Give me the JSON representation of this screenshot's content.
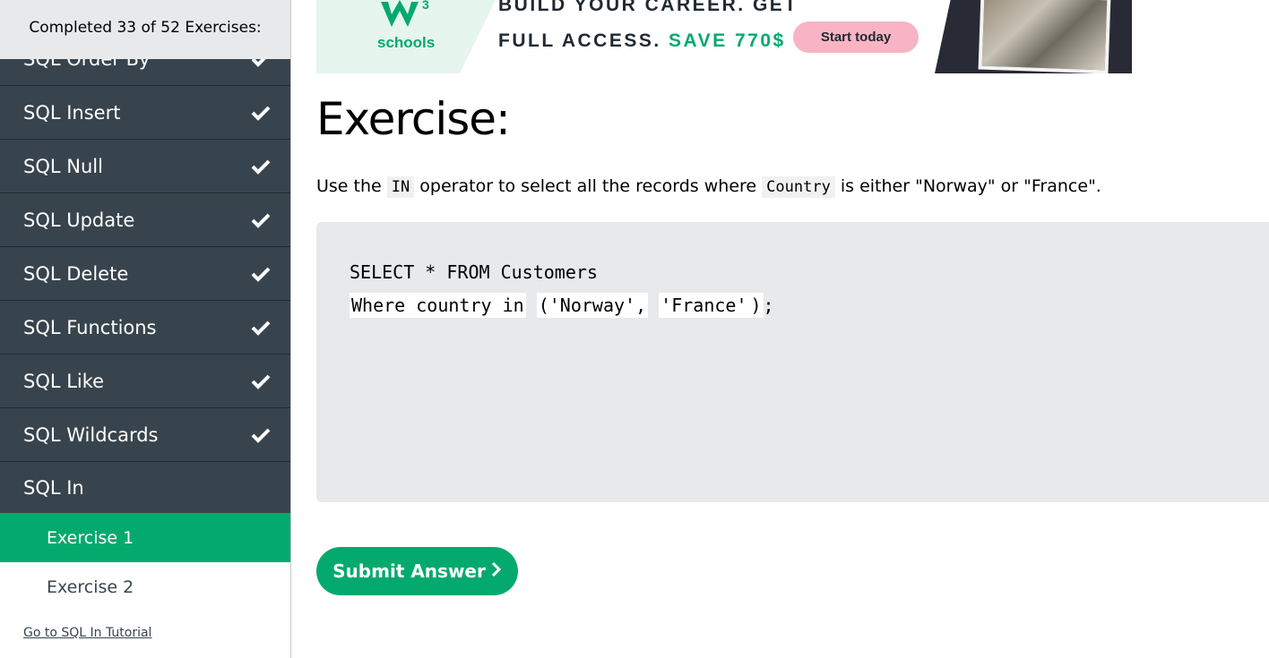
{
  "sidebar": {
    "progress_text": "Completed 33 of 52 Exercises:",
    "topics": [
      {
        "label": "SQL Order By",
        "completed": true
      },
      {
        "label": "SQL Insert",
        "completed": true
      },
      {
        "label": "SQL Null",
        "completed": true
      },
      {
        "label": "SQL Update",
        "completed": true
      },
      {
        "label": "SQL Delete",
        "completed": true
      },
      {
        "label": "SQL Functions",
        "completed": true
      },
      {
        "label": "SQL Like",
        "completed": true
      },
      {
        "label": "SQL Wildcards",
        "completed": true
      },
      {
        "label": "SQL In",
        "completed": false
      }
    ],
    "sub_items": [
      {
        "label": "Exercise 1",
        "selected": true
      },
      {
        "label": "Exercise 2",
        "selected": false
      }
    ],
    "tutorial_link": "Go to SQL In Tutorial"
  },
  "banner": {
    "logo_mark": "W",
    "logo_super": "3",
    "logo_word": "schools",
    "line1": "BUILD YOUR CAREER. GET",
    "line2_prefix": "FULL ACCESS.",
    "line2_highlight": "SAVE 770$",
    "cta_label": "Start today"
  },
  "exercise": {
    "heading": "Exercise:",
    "instruction": {
      "part1": "Use the",
      "code1": "IN",
      "part2": "operator to select all the records where",
      "code2": "Country",
      "part3": "is either \"Norway\" or \"France\"."
    },
    "code": {
      "line1": "SELECT * FROM Customers",
      "line2_answer1": "Where country in",
      "line2_answer2": "('Norway',",
      "line2_answer3": "'France'",
      "line2_suffix1": ")",
      "line2_suffix2": ";"
    },
    "submit_label": "Submit Answer",
    "submit_icon": "chevron-right-icon"
  },
  "colors": {
    "sidebar_bg": "#38444d",
    "accent_green": "#04aa6d",
    "code_bg": "#e7e9eb",
    "cta_pink": "#f8b4c4"
  }
}
